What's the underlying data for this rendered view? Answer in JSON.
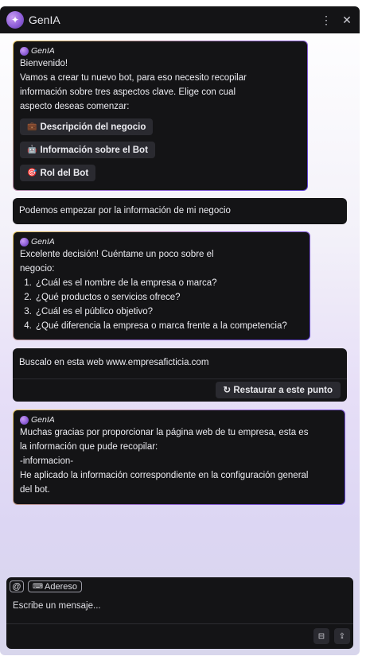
{
  "window": {
    "title": "GenIA"
  },
  "titlebar": {
    "menu_icon": "kebab-menu-icon",
    "close_icon": "close-icon"
  },
  "bot_name": "GenIA",
  "messages": {
    "m1": {
      "lines": [
        "Bienvenido!",
        "Vamos a crear tu nuevo bot, para eso necesito recopilar",
        "información sobre tres aspectos clave. Elige con cual",
        "aspecto deseas comenzar:"
      ],
      "options": [
        {
          "emoji": "💼",
          "label": "Descripción del negocio"
        },
        {
          "emoji": "🤖",
          "label": "Información sobre el Bot"
        },
        {
          "emoji": "🎯",
          "label": "Rol del Bot"
        }
      ]
    },
    "m2": {
      "text": "Podemos empezar por la información de mi negocio"
    },
    "m3": {
      "lines": [
        "Excelente decisión! Cuéntame un poco sobre el",
        "negocio:"
      ],
      "list": [
        "¿Cuál es el nombre de la empresa o marca?",
        "¿Qué productos o servicios ofrece?",
        "¿Cuál es el público objetivo?",
        "¿Qué diferencia la empresa o marca frente a la competencia?"
      ]
    },
    "m4": {
      "text": "Buscalo en esta web www.empresaficticia.com",
      "restore_label": "↻ Restaurar a este punto"
    },
    "m5": {
      "lines": [
        "Muchas gracias por proporcionar la página web de tu empresa, esta es",
        "la información que pude recopilar:",
        "-informacion-",
        "He aplicado la información correspondiente en la configuración general",
        "del bot."
      ]
    }
  },
  "composer": {
    "mention_label": "@",
    "tag_label": "Adereso",
    "placeholder": "Escribe un mensaje...",
    "attach_icon": "attachment-icon",
    "send_icon": "upload-icon"
  }
}
